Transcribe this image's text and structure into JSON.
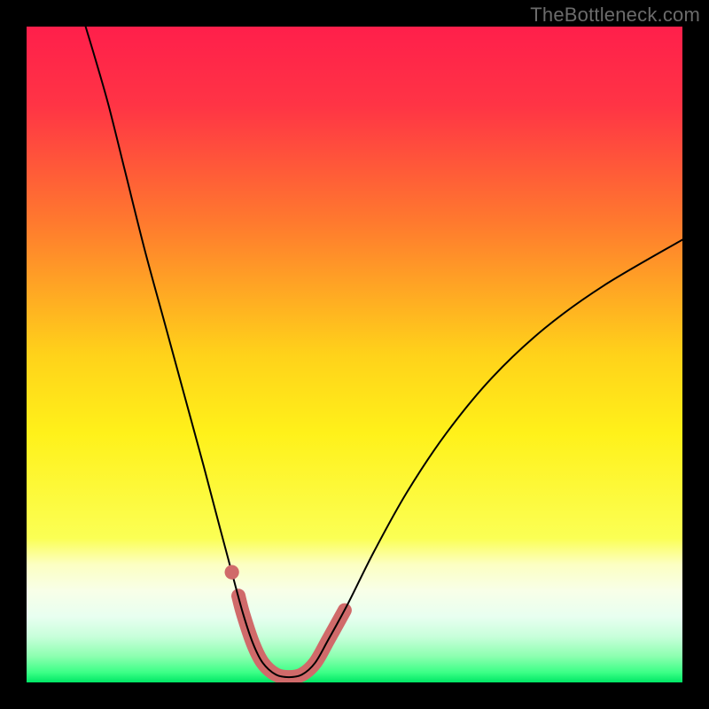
{
  "watermark": "TheBottleneck.com",
  "chart_data": {
    "type": "line",
    "title": "",
    "xlabel": "",
    "ylabel": "",
    "xlim": [
      0,
      100
    ],
    "ylim": [
      0,
      100
    ],
    "gradient_stops": [
      {
        "offset": 0.0,
        "color": "#ff1f4b"
      },
      {
        "offset": 0.12,
        "color": "#ff3445"
      },
      {
        "offset": 0.3,
        "color": "#ff7a2e"
      },
      {
        "offset": 0.5,
        "color": "#ffd21a"
      },
      {
        "offset": 0.62,
        "color": "#fff11a"
      },
      {
        "offset": 0.78,
        "color": "#fbff54"
      },
      {
        "offset": 0.82,
        "color": "#fcffc2"
      },
      {
        "offset": 0.86,
        "color": "#f8ffe8"
      },
      {
        "offset": 0.9,
        "color": "#e8fff0"
      },
      {
        "offset": 0.93,
        "color": "#c8ffdb"
      },
      {
        "offset": 0.96,
        "color": "#8dffb0"
      },
      {
        "offset": 0.985,
        "color": "#3bff86"
      },
      {
        "offset": 1.0,
        "color": "#00e765"
      }
    ],
    "series": [
      {
        "name": "bottleneck-curve",
        "stroke": "#000000",
        "stroke_width": 2,
        "points": [
          {
            "x": 9.0,
            "y": 100.0
          },
          {
            "x": 10.5,
            "y": 95.0
          },
          {
            "x": 12.5,
            "y": 88.0
          },
          {
            "x": 15.0,
            "y": 78.0
          },
          {
            "x": 18.0,
            "y": 66.0
          },
          {
            "x": 21.0,
            "y": 55.0
          },
          {
            "x": 24.0,
            "y": 44.0
          },
          {
            "x": 27.0,
            "y": 33.0
          },
          {
            "x": 29.5,
            "y": 23.5
          },
          {
            "x": 31.5,
            "y": 16.0
          },
          {
            "x": 33.0,
            "y": 10.5
          },
          {
            "x": 34.5,
            "y": 6.0
          },
          {
            "x": 36.0,
            "y": 3.0
          },
          {
            "x": 38.0,
            "y": 1.2
          },
          {
            "x": 40.0,
            "y": 0.8
          },
          {
            "x": 42.0,
            "y": 1.2
          },
          {
            "x": 44.0,
            "y": 3.0
          },
          {
            "x": 46.0,
            "y": 6.5
          },
          {
            "x": 49.0,
            "y": 12.0
          },
          {
            "x": 53.0,
            "y": 20.0
          },
          {
            "x": 58.0,
            "y": 29.0
          },
          {
            "x": 64.0,
            "y": 38.0
          },
          {
            "x": 71.0,
            "y": 46.5
          },
          {
            "x": 79.0,
            "y": 54.0
          },
          {
            "x": 88.0,
            "y": 60.5
          },
          {
            "x": 100.0,
            "y": 67.5
          }
        ]
      },
      {
        "name": "highlight-band",
        "stroke": "#d06a6a",
        "stroke_width": 16,
        "points": [
          {
            "x": 32.3,
            "y": 13.2
          },
          {
            "x": 33.0,
            "y": 10.5
          },
          {
            "x": 34.5,
            "y": 6.0
          },
          {
            "x": 36.0,
            "y": 3.0
          },
          {
            "x": 38.0,
            "y": 1.2
          },
          {
            "x": 40.0,
            "y": 0.8
          },
          {
            "x": 42.0,
            "y": 1.2
          },
          {
            "x": 44.0,
            "y": 3.0
          },
          {
            "x": 46.0,
            "y": 6.5
          },
          {
            "x": 48.5,
            "y": 11.0
          }
        ]
      }
    ],
    "markers": [
      {
        "name": "dot-left",
        "x": 31.3,
        "y": 16.8,
        "r": 1.1,
        "color": "#d06a6a"
      }
    ]
  }
}
